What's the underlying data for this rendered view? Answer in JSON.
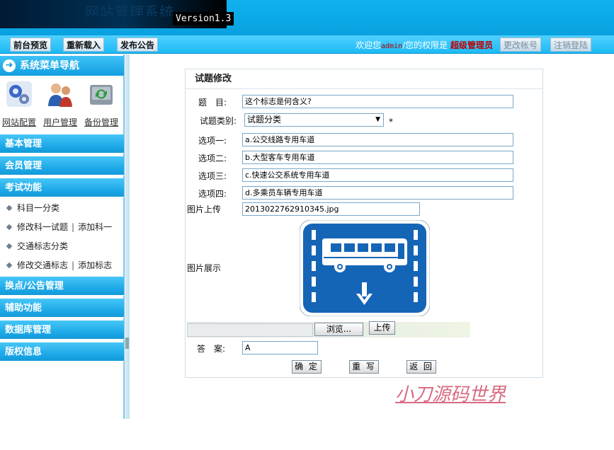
{
  "banner": {
    "site_title": "网站管理系统",
    "version": "Version1.3"
  },
  "toolbar": {
    "preview": "前台预览",
    "reload": "重新载入",
    "publish": "发布公告",
    "welcome_prefix": "欢迎您",
    "username": "admin",
    "welcome_mid": "/您的权限是",
    "role": "超级管理员",
    "change_account": "更改帐号",
    "logout": "注销登陆"
  },
  "sidebar": {
    "nav_title": "系统菜单导航",
    "quick": [
      {
        "label": "网站配置",
        "icon": "gears-icon"
      },
      {
        "label": "用户管理",
        "icon": "users-icon"
      },
      {
        "label": "备份管理",
        "icon": "backup-icon"
      }
    ],
    "sections": {
      "basic": "基本管理",
      "member": "会员管理",
      "exam": "考试功能",
      "points": "换点/公告管理",
      "aux": "辅助功能",
      "db": "数据库管理",
      "copyright": "版权信息"
    },
    "exam_items": {
      "item1": "科目一分类",
      "item2a": "修改科一试题",
      "item2b": "添加科一",
      "item3": "交通标志分类",
      "item4a": "修改交通标志",
      "item4b": "添加标志",
      "sep": "|"
    }
  },
  "form": {
    "title": "试题修改",
    "question_label": "题　目:",
    "question_value": "这个标志是何含义?",
    "category_label": "试题类别:",
    "category_value": "试题分类",
    "required_mark": "*",
    "opt1_label": "选项一:",
    "opt1_value": "a.公交线路专用车道",
    "opt2_label": "选项二:",
    "opt2_value": "b.大型客车专用车道",
    "opt3_label": "选项三:",
    "opt3_value": "c.快速公交系统专用车道",
    "opt4_label": "选项四:",
    "opt4_value": "d.多乘员车辆专用车道",
    "upload_label": "图片上传",
    "upload_value": "2013022762910345.jpg",
    "display_label": "图片展示",
    "browse_button": "浏览...",
    "upload_button": "上传",
    "answer_label": "答　案:",
    "answer_value": "A",
    "ok_button": "确 定",
    "reset_button": "重 写",
    "back_button": "返 回"
  },
  "watermark": "小刀源码世界",
  "colors": {
    "banner": "#0aa8e6",
    "section": "#1aa6e6",
    "sign_blue": "#1565b6",
    "watermark": "#d86a80"
  }
}
